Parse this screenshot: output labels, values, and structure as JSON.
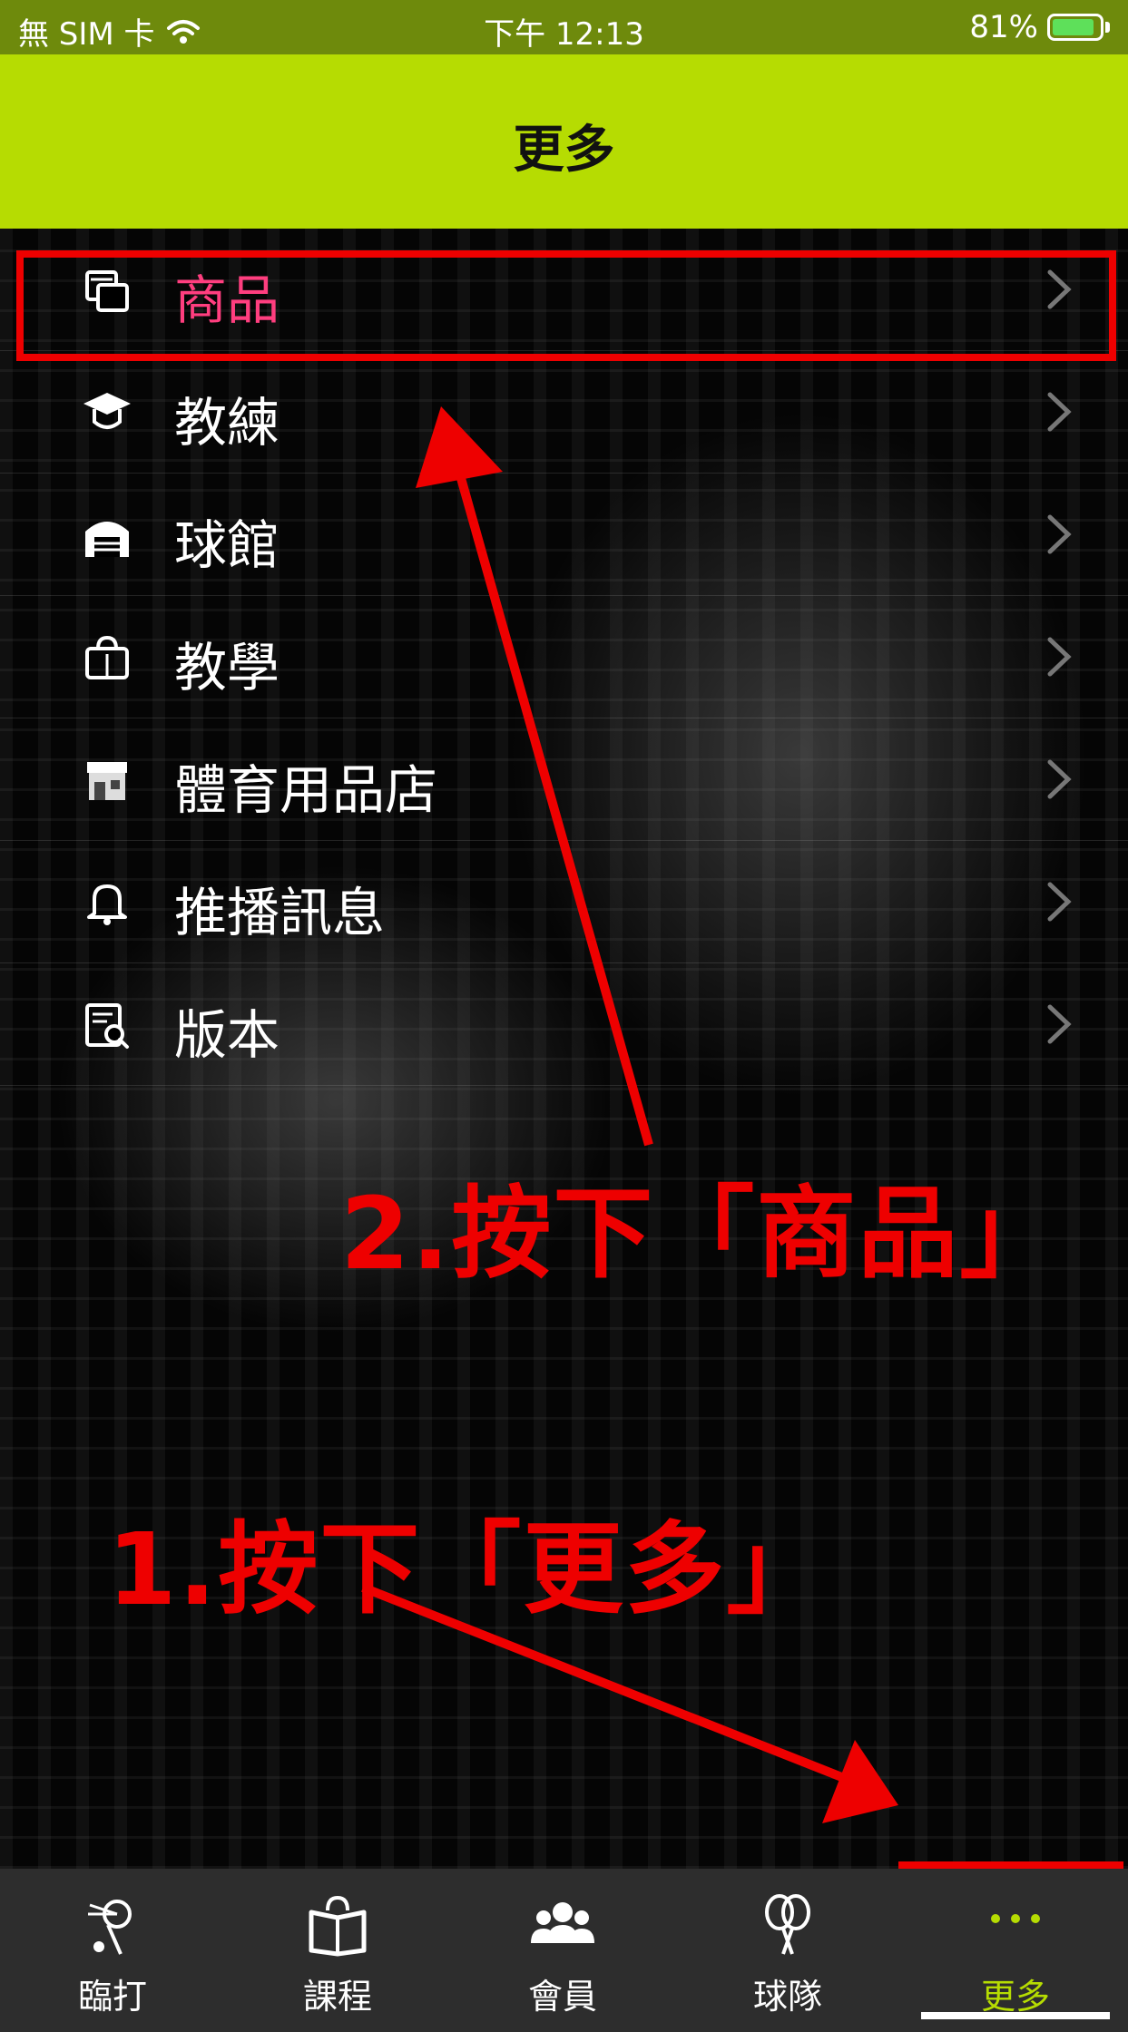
{
  "status_bar": {
    "carrier": "無 SIM 卡",
    "time": "下午 12:13",
    "battery": "81%"
  },
  "header": {
    "title": "更多"
  },
  "menu": {
    "items": [
      {
        "label": "商品",
        "icon": "product-icon"
      },
      {
        "label": "教練",
        "icon": "coach-icon"
      },
      {
        "label": "球館",
        "icon": "venue-icon"
      },
      {
        "label": "教學",
        "icon": "teaching-icon"
      },
      {
        "label": "體育用品店",
        "icon": "store-icon"
      },
      {
        "label": "推播訊息",
        "icon": "bell-icon"
      },
      {
        "label": "版本",
        "icon": "version-icon"
      }
    ]
  },
  "annotations": {
    "step1": "1.按下「更多」",
    "step2": "2.按下「商品」"
  },
  "tabbar": {
    "tabs": [
      {
        "label": "臨打",
        "icon": "shuttlecock-icon"
      },
      {
        "label": "課程",
        "icon": "book-icon"
      },
      {
        "label": "會員",
        "icon": "members-icon"
      },
      {
        "label": "球隊",
        "icon": "team-racket-icon"
      },
      {
        "label": "更多",
        "icon": "more-dots-icon"
      }
    ]
  },
  "colors": {
    "accent": "#b6dc02",
    "active_label": "#ff3e7f",
    "annotation": "#ee0000"
  }
}
